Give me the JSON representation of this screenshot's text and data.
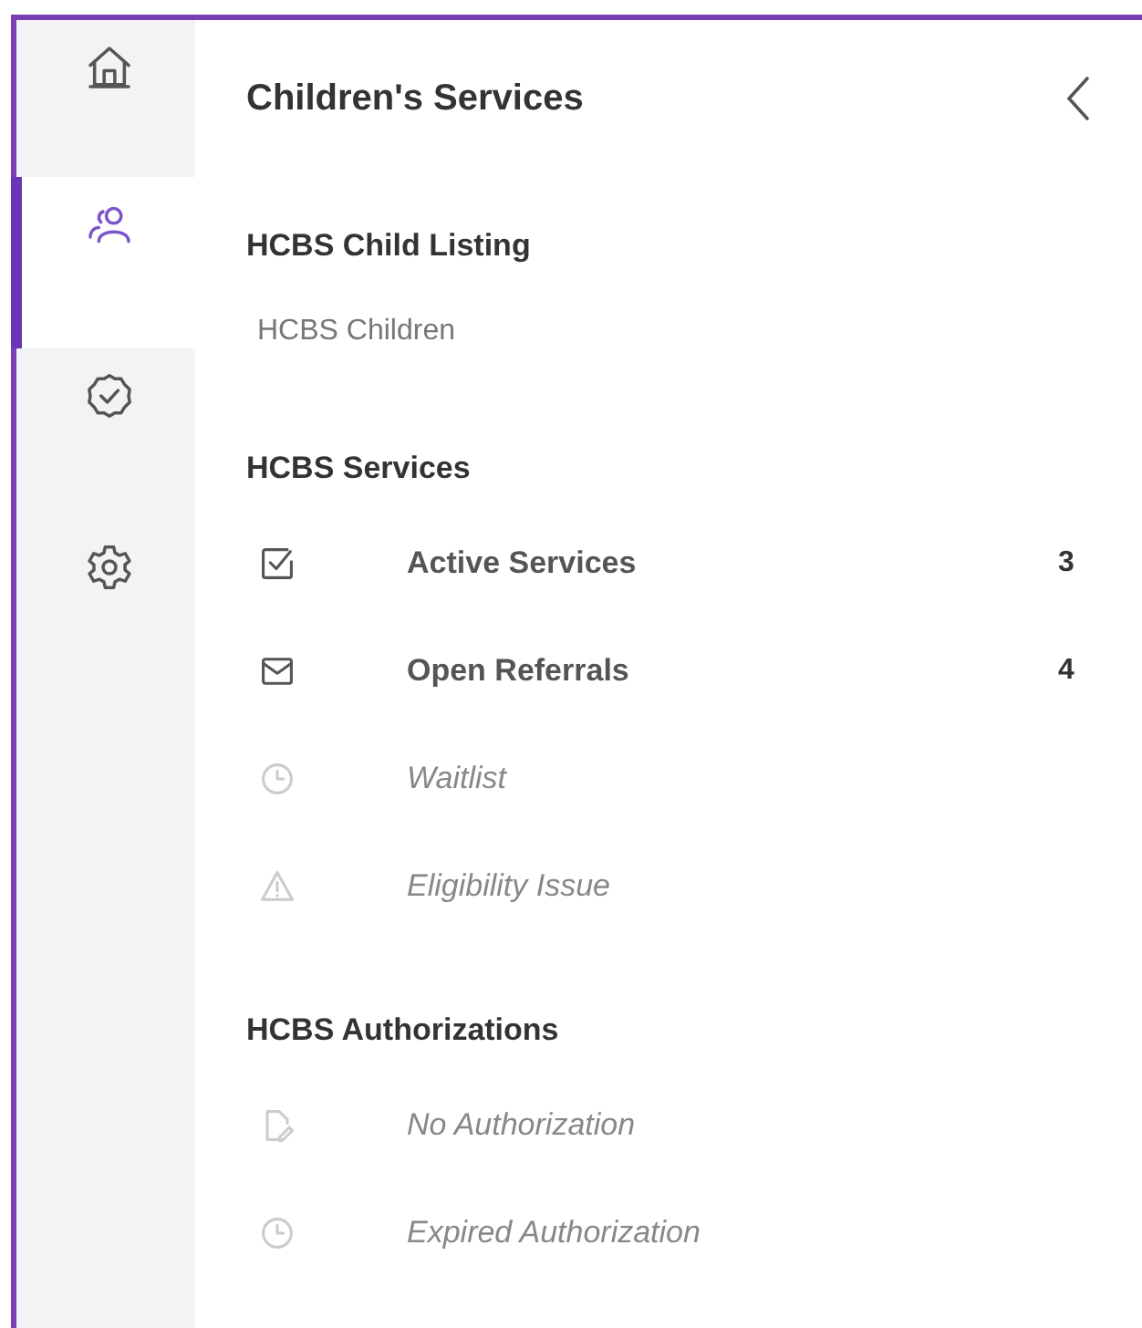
{
  "rail": [
    {
      "selected": false
    },
    {
      "selected": true
    },
    {
      "selected": false
    },
    {
      "selected": false
    }
  ],
  "panel": {
    "title": "Children's Services",
    "sections": [
      {
        "heading": "HCBS Child Listing",
        "links": [
          "HCBS Children"
        ]
      },
      {
        "heading": "HCBS Services",
        "items": [
          {
            "kind": "checkbox",
            "label": "Active Services",
            "count": "3",
            "disabled": false
          },
          {
            "kind": "mail",
            "label": "Open Referrals",
            "count": "4",
            "disabled": false
          },
          {
            "kind": "clock",
            "label": "Waitlist",
            "disabled": true
          },
          {
            "kind": "warning",
            "label": "Eligibility Issue",
            "disabled": true
          }
        ]
      },
      {
        "heading": "HCBS Authorizations",
        "items": [
          {
            "kind": "document",
            "label": "No Authorization",
            "disabled": true
          },
          {
            "kind": "clock",
            "label": "Expired Authorization",
            "disabled": true
          }
        ]
      }
    ]
  }
}
